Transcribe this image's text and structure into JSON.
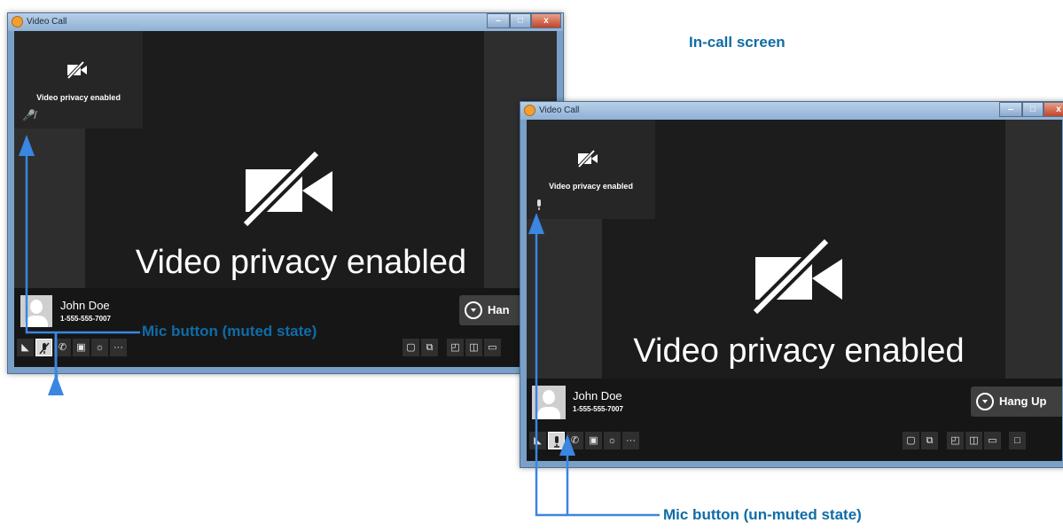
{
  "window_left": {
    "title": "Video Call",
    "self_view_label": "Video privacy enabled",
    "main_label": "Video privacy enabled",
    "caller_name": "John Doe",
    "caller_number": "1-555-555-7007",
    "hang_up_label": "Han"
  },
  "window_right": {
    "title": "Video Call",
    "self_view_label": "Video privacy enabled",
    "main_label": "Video privacy enabled",
    "caller_name": "John Doe",
    "caller_number": "1-555-555-7007",
    "hang_up_label": "Hang Up"
  },
  "annotations": {
    "screen_title": "In-call screen",
    "muted_label": "Mic button (muted state)",
    "unmuted_label": "Mic button (un-muted state)"
  },
  "toolbar_icons": {
    "video_toggle": "video-off-icon",
    "mic": "mic-icon",
    "dial": "phone-icon",
    "chat": "message-icon",
    "brightness": "brightness-icon",
    "more": "ellipsis-icon",
    "contact": "contact-card-icon",
    "share": "share-icon",
    "layout_a": "layout-pip-icon",
    "layout_b": "layout-split-icon",
    "layout_c": "layout-wide-icon",
    "fullscreen": "fullscreen-icon"
  },
  "colors": {
    "annotation_text": "#0f6ca6",
    "arrow": "#3a86e0",
    "window_frame": "#7aa0c8",
    "video_background": "#1c1c1c"
  }
}
